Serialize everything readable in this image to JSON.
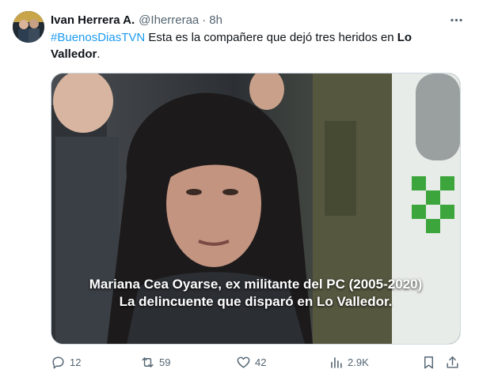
{
  "tweet": {
    "author_name": "Ivan Herrera A.",
    "handle": "@Iherreraa",
    "separator": "·",
    "time": "8h",
    "text": {
      "hashtag": "#BuenosDiasTVN",
      "body": " Esta es la compañere que dejó tres heridos en ",
      "place_bold_1": "Lo",
      "place_bold_2": "Valledor",
      "end": "."
    },
    "media": {
      "caption_line1": "Mariana Cea Oyarse, ex militante del PC (2005-2020)",
      "caption_line2": "La delincuente que disparó en Lo Valledor."
    },
    "actions": {
      "replies": "12",
      "reposts": "59",
      "likes": "42",
      "views": "2.9K"
    }
  },
  "colors": {
    "link": "#1d9bf0",
    "secondary_text": "#536471",
    "border": "#cfd9de"
  },
  "icons": [
    "more-icon",
    "reply-icon",
    "repost-icon",
    "like-icon",
    "views-icon",
    "bookmark-icon",
    "share-icon"
  ]
}
